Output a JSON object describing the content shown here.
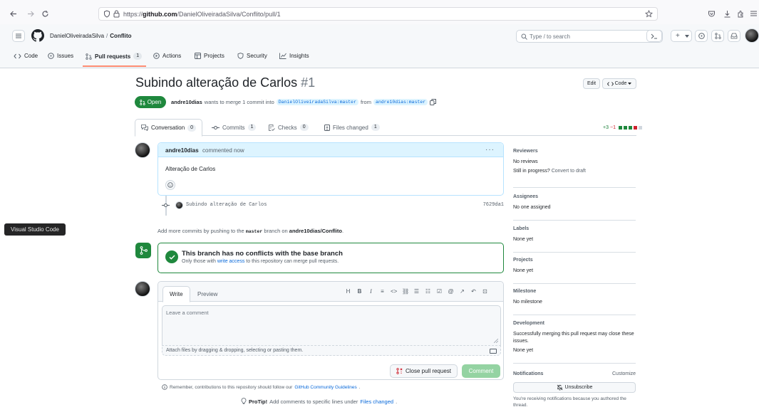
{
  "browser": {
    "url_prefix": "https://",
    "url_domain": "github.com",
    "url_path": "/DanielOliveiradaSilva/Conflito/pull/1"
  },
  "header": {
    "owner": "DanielOliveiradaSilva",
    "separator": "/",
    "repo": "Conflito",
    "search_placeholder": "Type / to search",
    "slash_key": "/",
    "plus": "+"
  },
  "repo_tabs": [
    {
      "label": "Code",
      "icon": "code-icon"
    },
    {
      "label": "Issues",
      "icon": "issue-icon"
    },
    {
      "label": "Pull requests",
      "count": "1",
      "icon": "pull-request-icon"
    },
    {
      "label": "Actions",
      "icon": "play-icon"
    },
    {
      "label": "Projects",
      "icon": "table-icon"
    },
    {
      "label": "Security",
      "icon": "shield-icon"
    },
    {
      "label": "Insights",
      "icon": "graph-icon"
    }
  ],
  "pr": {
    "title": "Subindo alteração de Carlos",
    "number": "#1",
    "state": "Open",
    "author": "andre10dias",
    "merge_text": "wants to merge 1 commit into",
    "base_branch": "DanielOliveiradaSilva:master",
    "from_text": "from",
    "head_branch": "andre10dias:master",
    "edit_label": "Edit",
    "code_label": "Code"
  },
  "pr_tabs": [
    {
      "label": "Conversation",
      "count": "0"
    },
    {
      "label": "Commits",
      "count": "1"
    },
    {
      "label": "Checks",
      "count": "0"
    },
    {
      "label": "Files changed",
      "count": "1"
    }
  ],
  "diff": {
    "additions": "+3",
    "deletions": "−1"
  },
  "comment": {
    "author": "andre10dias",
    "time": "commented now",
    "menu": "···",
    "body": "Alteração de Carlos"
  },
  "commit": {
    "message": "Subindo alteração de Carlos",
    "sha": "7629da1"
  },
  "push_hint": {
    "pre": "Add more commits by pushing to the",
    "branch": "master",
    "mid": "branch on",
    "repo": "andre10dias/Conflito",
    "end": "."
  },
  "merge": {
    "title": "This branch has no conflicts with the base branch",
    "sub_pre": "Only those with",
    "sub_link": "write access",
    "sub_post": "to this repository can merge pull requests."
  },
  "editor": {
    "write_tab": "Write",
    "preview_tab": "Preview",
    "toolbar": [
      "H",
      "B",
      "I",
      "≡",
      "<>",
      "⛓",
      "☰",
      "☷",
      "☑",
      "@",
      "↗",
      "↶",
      "⊡"
    ],
    "placeholder": "Leave a comment",
    "attach": "Attach files by dragging & dropping, selecting or pasting them.",
    "close_label": "Close pull request",
    "comment_label": "Comment"
  },
  "guidelines": {
    "pre": "Remember, contributions to this repository should follow our",
    "link": "GitHub Community Guidelines",
    "end": "."
  },
  "protip": {
    "label": "ProTip!",
    "pre": "Add comments to specific lines under",
    "link": "Files changed",
    "end": "."
  },
  "sidebar": {
    "reviewers_head": "Reviewers",
    "reviewers_val": "No reviews",
    "reviewers_progress": "Still in progress?",
    "reviewers_draft": "Convert to draft",
    "assignees_head": "Assignees",
    "assignees_val": "No one assigned",
    "labels_head": "Labels",
    "labels_val": "None yet",
    "projects_head": "Projects",
    "projects_val": "None yet",
    "milestone_head": "Milestone",
    "milestone_val": "No milestone",
    "development_head": "Development",
    "development_val": "Successfully merging this pull request may close these issues.",
    "development_val2": "None yet",
    "notifications_head": "Notifications",
    "customize": "Customize",
    "unsubscribe": "Unsubscribe",
    "notif_note": "You're receiving notifications because you authored the thread."
  },
  "tooltip": "Visual Studio Code",
  "colors": {
    "accent_green": "#1f883d",
    "link_blue": "#0969da",
    "tab_underline": "#fd8c73"
  }
}
